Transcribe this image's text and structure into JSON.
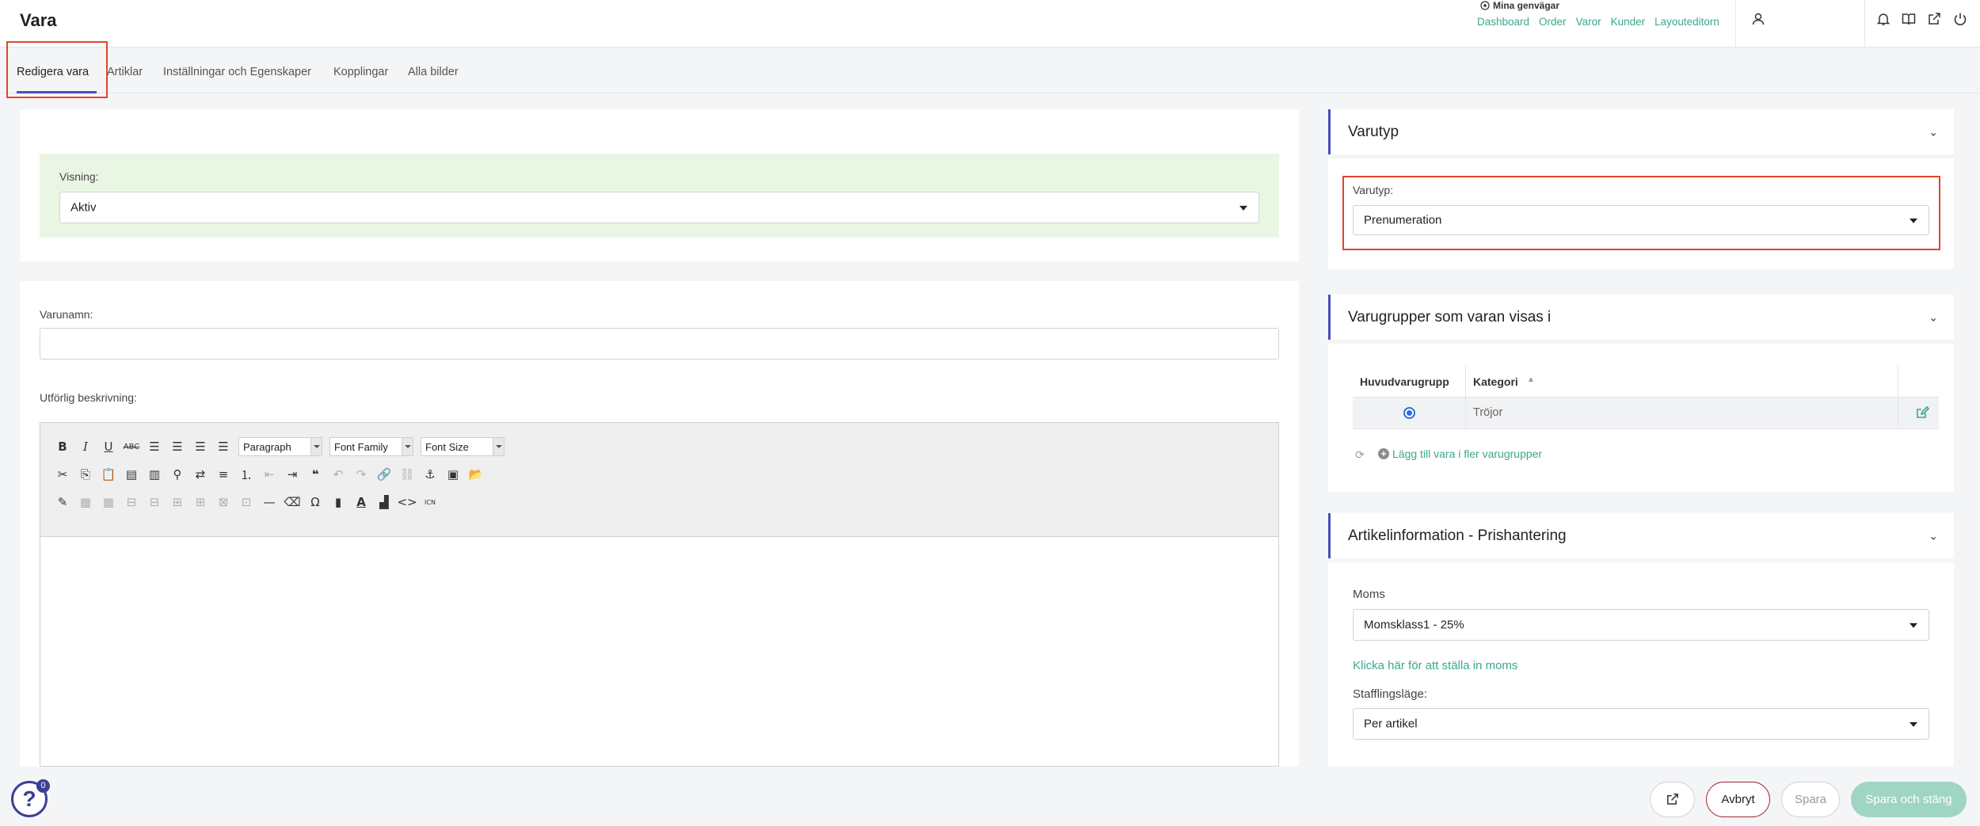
{
  "header": {
    "title": "Vara",
    "shortcuts_title": "Mina genvägar",
    "shortcuts": [
      "Dashboard",
      "Order",
      "Varor",
      "Kunder",
      "Layouteditorn"
    ]
  },
  "tabs": [
    {
      "label": "Redigera vara"
    },
    {
      "label": "Artiklar"
    },
    {
      "label": "Inställningar och Egenskaper"
    },
    {
      "label": "Kopplingar"
    },
    {
      "label": "Alla bilder"
    }
  ],
  "visning": {
    "label": "Visning:",
    "value": "Aktiv"
  },
  "varunamn": {
    "label": "Varunamn:",
    "value": ""
  },
  "beskrivning": {
    "label": "Utförlig beskrivning:",
    "format_select": "Paragraph",
    "font_family_select": "Font Family",
    "font_size_select": "Font Size"
  },
  "varutyp_panel": {
    "title": "Varutyp",
    "field_label": "Varutyp:",
    "value": "Prenumeration"
  },
  "varugrupper_panel": {
    "title": "Varugrupper som varan visas i",
    "columns": [
      "Huvudvarugrupp",
      "Kategori"
    ],
    "rows": [
      {
        "kategori": "Tröjor",
        "selected": true
      }
    ],
    "add_link": "Lägg till vara i fler varugrupper"
  },
  "pris_panel": {
    "title": "Artikelinformation - Prishantering",
    "moms_label": "Moms",
    "moms_value": "Momsklass1 - 25%",
    "moms_link": "Klicka här för att ställa in moms",
    "staffling_label": "Stafflingsläge:",
    "staffling_value": "Per artikel"
  },
  "footer": {
    "help_badge": "0",
    "cancel": "Avbryt",
    "save": "Spara",
    "save_close": "Spara och stäng"
  },
  "colors": {
    "accent": "#3aa88f",
    "primary": "#4b4fb5",
    "danger": "#a0262f",
    "highlight": "#e5432b"
  }
}
